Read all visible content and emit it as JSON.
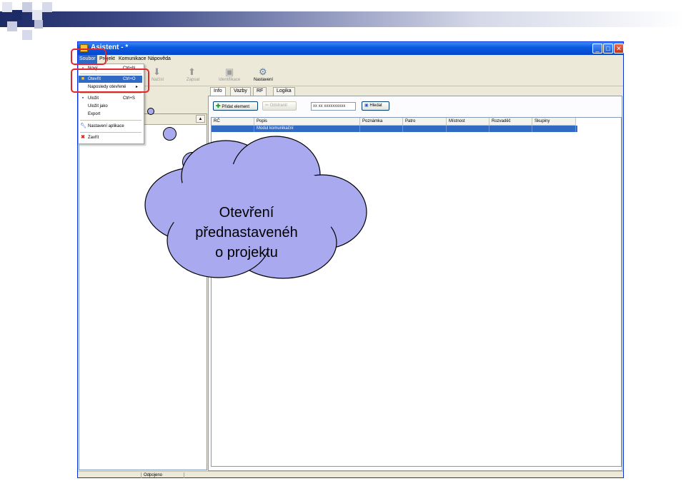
{
  "window": {
    "title": "Asistent - *",
    "controls": [
      "_",
      "□",
      "✕"
    ]
  },
  "menubar": {
    "items": [
      "Soubor",
      "Projekt",
      "Komunikace",
      "Nápověda"
    ]
  },
  "toolbar": {
    "buttons": [
      {
        "label": "Načíst",
        "icon": "arrow-down-icon"
      },
      {
        "label": "Zapsat",
        "icon": "arrow-up-icon"
      },
      {
        "label": "Identifikace",
        "icon": "binoculars-icon"
      },
      {
        "label": "Nastavení",
        "icon": "gear-icon"
      }
    ]
  },
  "file_menu": {
    "items": [
      {
        "label": "Nový",
        "shortcut": "Ctrl+N",
        "icon": "new-file-icon"
      },
      {
        "label": "Otevřít",
        "shortcut": "Ctrl+O",
        "icon": "folder-icon"
      },
      {
        "label": "Naposledy otevřené",
        "shortcut": "",
        "icon": ""
      },
      {
        "label": "Uložit",
        "shortcut": "Ctrl+S",
        "icon": "save-icon"
      },
      {
        "label": "Uložit jako",
        "shortcut": "",
        "icon": ""
      },
      {
        "label": "Export",
        "shortcut": "",
        "icon": ""
      },
      {
        "label": "Nastavení aplikace",
        "shortcut": "",
        "icon": "wrench-icon"
      },
      {
        "label": "Zavřít",
        "shortcut": "",
        "icon": "close-icon"
      }
    ],
    "submenu_arrow": "▸"
  },
  "tabs": [
    "Info",
    "Vazby",
    "RF",
    "Logika"
  ],
  "actions": {
    "add_label": "Přidat element",
    "remove_label": "Odstranit",
    "search_value": "xx xx xxxxxxxxxx",
    "find_label": "Hledat"
  },
  "grid": {
    "columns": [
      "RČ",
      "Popis",
      "Poznámka",
      "Patro",
      "Místnost",
      "Rozvaděč",
      "Skupiny"
    ],
    "rows": [
      [
        "",
        "Modul komunikační",
        "",
        "",
        "",
        "",
        ""
      ]
    ]
  },
  "statusbar": {
    "status": "Odpojeno"
  },
  "callout": {
    "lines": [
      "Otevření",
      "přednastavenéh",
      "o projektu"
    ]
  },
  "colors": {
    "highlight": "#e3262b",
    "cloud_fill": "#a9a9f0",
    "selection": "#316ac5"
  }
}
